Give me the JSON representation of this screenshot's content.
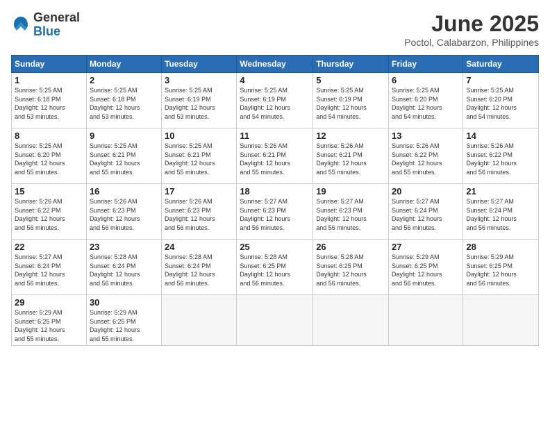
{
  "logo": {
    "general": "General",
    "blue": "Blue"
  },
  "title": "June 2025",
  "location": "Poctol, Calabarzon, Philippines",
  "days_header": [
    "Sunday",
    "Monday",
    "Tuesday",
    "Wednesday",
    "Thursday",
    "Friday",
    "Saturday"
  ],
  "weeks": [
    [
      {
        "day": "1",
        "info": "Sunrise: 5:25 AM\nSunset: 6:18 PM\nDaylight: 12 hours\nand 53 minutes."
      },
      {
        "day": "2",
        "info": "Sunrise: 5:25 AM\nSunset: 6:18 PM\nDaylight: 12 hours\nand 53 minutes."
      },
      {
        "day": "3",
        "info": "Sunrise: 5:25 AM\nSunset: 6:19 PM\nDaylight: 12 hours\nand 53 minutes."
      },
      {
        "day": "4",
        "info": "Sunrise: 5:25 AM\nSunset: 6:19 PM\nDaylight: 12 hours\nand 54 minutes."
      },
      {
        "day": "5",
        "info": "Sunrise: 5:25 AM\nSunset: 6:19 PM\nDaylight: 12 hours\nand 54 minutes."
      },
      {
        "day": "6",
        "info": "Sunrise: 5:25 AM\nSunset: 6:20 PM\nDaylight: 12 hours\nand 54 minutes."
      },
      {
        "day": "7",
        "info": "Sunrise: 5:25 AM\nSunset: 6:20 PM\nDaylight: 12 hours\nand 54 minutes."
      }
    ],
    [
      {
        "day": "8",
        "info": "Sunrise: 5:25 AM\nSunset: 6:20 PM\nDaylight: 12 hours\nand 55 minutes."
      },
      {
        "day": "9",
        "info": "Sunrise: 5:25 AM\nSunset: 6:21 PM\nDaylight: 12 hours\nand 55 minutes."
      },
      {
        "day": "10",
        "info": "Sunrise: 5:25 AM\nSunset: 6:21 PM\nDaylight: 12 hours\nand 55 minutes."
      },
      {
        "day": "11",
        "info": "Sunrise: 5:26 AM\nSunset: 6:21 PM\nDaylight: 12 hours\nand 55 minutes."
      },
      {
        "day": "12",
        "info": "Sunrise: 5:26 AM\nSunset: 6:21 PM\nDaylight: 12 hours\nand 55 minutes."
      },
      {
        "day": "13",
        "info": "Sunrise: 5:26 AM\nSunset: 6:22 PM\nDaylight: 12 hours\nand 55 minutes."
      },
      {
        "day": "14",
        "info": "Sunrise: 5:26 AM\nSunset: 6:22 PM\nDaylight: 12 hours\nand 56 minutes."
      }
    ],
    [
      {
        "day": "15",
        "info": "Sunrise: 5:26 AM\nSunset: 6:22 PM\nDaylight: 12 hours\nand 56 minutes."
      },
      {
        "day": "16",
        "info": "Sunrise: 5:26 AM\nSunset: 6:23 PM\nDaylight: 12 hours\nand 56 minutes."
      },
      {
        "day": "17",
        "info": "Sunrise: 5:26 AM\nSunset: 6:23 PM\nDaylight: 12 hours\nand 56 minutes."
      },
      {
        "day": "18",
        "info": "Sunrise: 5:27 AM\nSunset: 6:23 PM\nDaylight: 12 hours\nand 56 minutes."
      },
      {
        "day": "19",
        "info": "Sunrise: 5:27 AM\nSunset: 6:23 PM\nDaylight: 12 hours\nand 56 minutes."
      },
      {
        "day": "20",
        "info": "Sunrise: 5:27 AM\nSunset: 6:24 PM\nDaylight: 12 hours\nand 56 minutes."
      },
      {
        "day": "21",
        "info": "Sunrise: 5:27 AM\nSunset: 6:24 PM\nDaylight: 12 hours\nand 56 minutes."
      }
    ],
    [
      {
        "day": "22",
        "info": "Sunrise: 5:27 AM\nSunset: 6:24 PM\nDaylight: 12 hours\nand 56 minutes."
      },
      {
        "day": "23",
        "info": "Sunrise: 5:28 AM\nSunset: 6:24 PM\nDaylight: 12 hours\nand 56 minutes."
      },
      {
        "day": "24",
        "info": "Sunrise: 5:28 AM\nSunset: 6:24 PM\nDaylight: 12 hours\nand 56 minutes."
      },
      {
        "day": "25",
        "info": "Sunrise: 5:28 AM\nSunset: 6:25 PM\nDaylight: 12 hours\nand 56 minutes."
      },
      {
        "day": "26",
        "info": "Sunrise: 5:28 AM\nSunset: 6:25 PM\nDaylight: 12 hours\nand 56 minutes."
      },
      {
        "day": "27",
        "info": "Sunrise: 5:29 AM\nSunset: 6:25 PM\nDaylight: 12 hours\nand 56 minutes."
      },
      {
        "day": "28",
        "info": "Sunrise: 5:29 AM\nSunset: 6:25 PM\nDaylight: 12 hours\nand 56 minutes."
      }
    ],
    [
      {
        "day": "29",
        "info": "Sunrise: 5:29 AM\nSunset: 6:25 PM\nDaylight: 12 hours\nand 55 minutes."
      },
      {
        "day": "30",
        "info": "Sunrise: 5:29 AM\nSunset: 6:25 PM\nDaylight: 12 hours\nand 55 minutes."
      },
      {
        "day": "",
        "info": ""
      },
      {
        "day": "",
        "info": ""
      },
      {
        "day": "",
        "info": ""
      },
      {
        "day": "",
        "info": ""
      },
      {
        "day": "",
        "info": ""
      }
    ]
  ]
}
